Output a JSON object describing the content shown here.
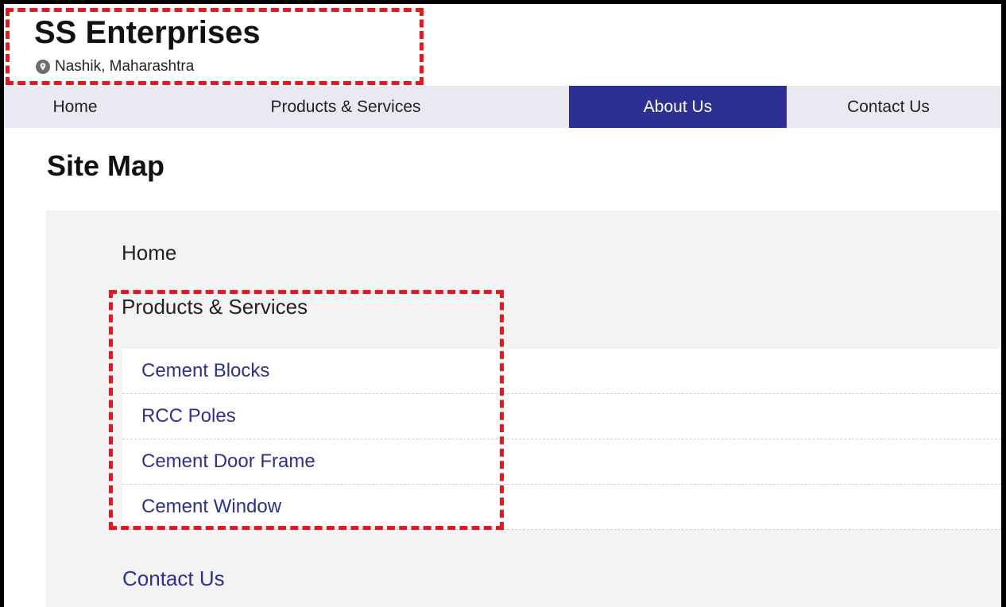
{
  "header": {
    "company_name": "SS Enterprises",
    "location": "Nashik, Maharashtra",
    "location_icon": "map-pin-icon"
  },
  "nav": {
    "items": [
      {
        "label": "Home",
        "active": false
      },
      {
        "label": "Products & Services",
        "active": false
      },
      {
        "label": "About Us",
        "active": true
      },
      {
        "label": "Contact Us",
        "active": false
      }
    ]
  },
  "page": {
    "title": "Site Map"
  },
  "sitemap": {
    "home": "Home",
    "products_heading": "Products & Services",
    "products": [
      "Cement Blocks",
      "RCC Poles",
      "Cement Door Frame",
      "Cement Window"
    ],
    "contact": "Contact Us"
  },
  "colors": {
    "brand_blue": "#2d3092",
    "nav_background": "#e9e9f1",
    "highlight_red": "#e8171f",
    "panel_background": "#f3f3f3"
  }
}
